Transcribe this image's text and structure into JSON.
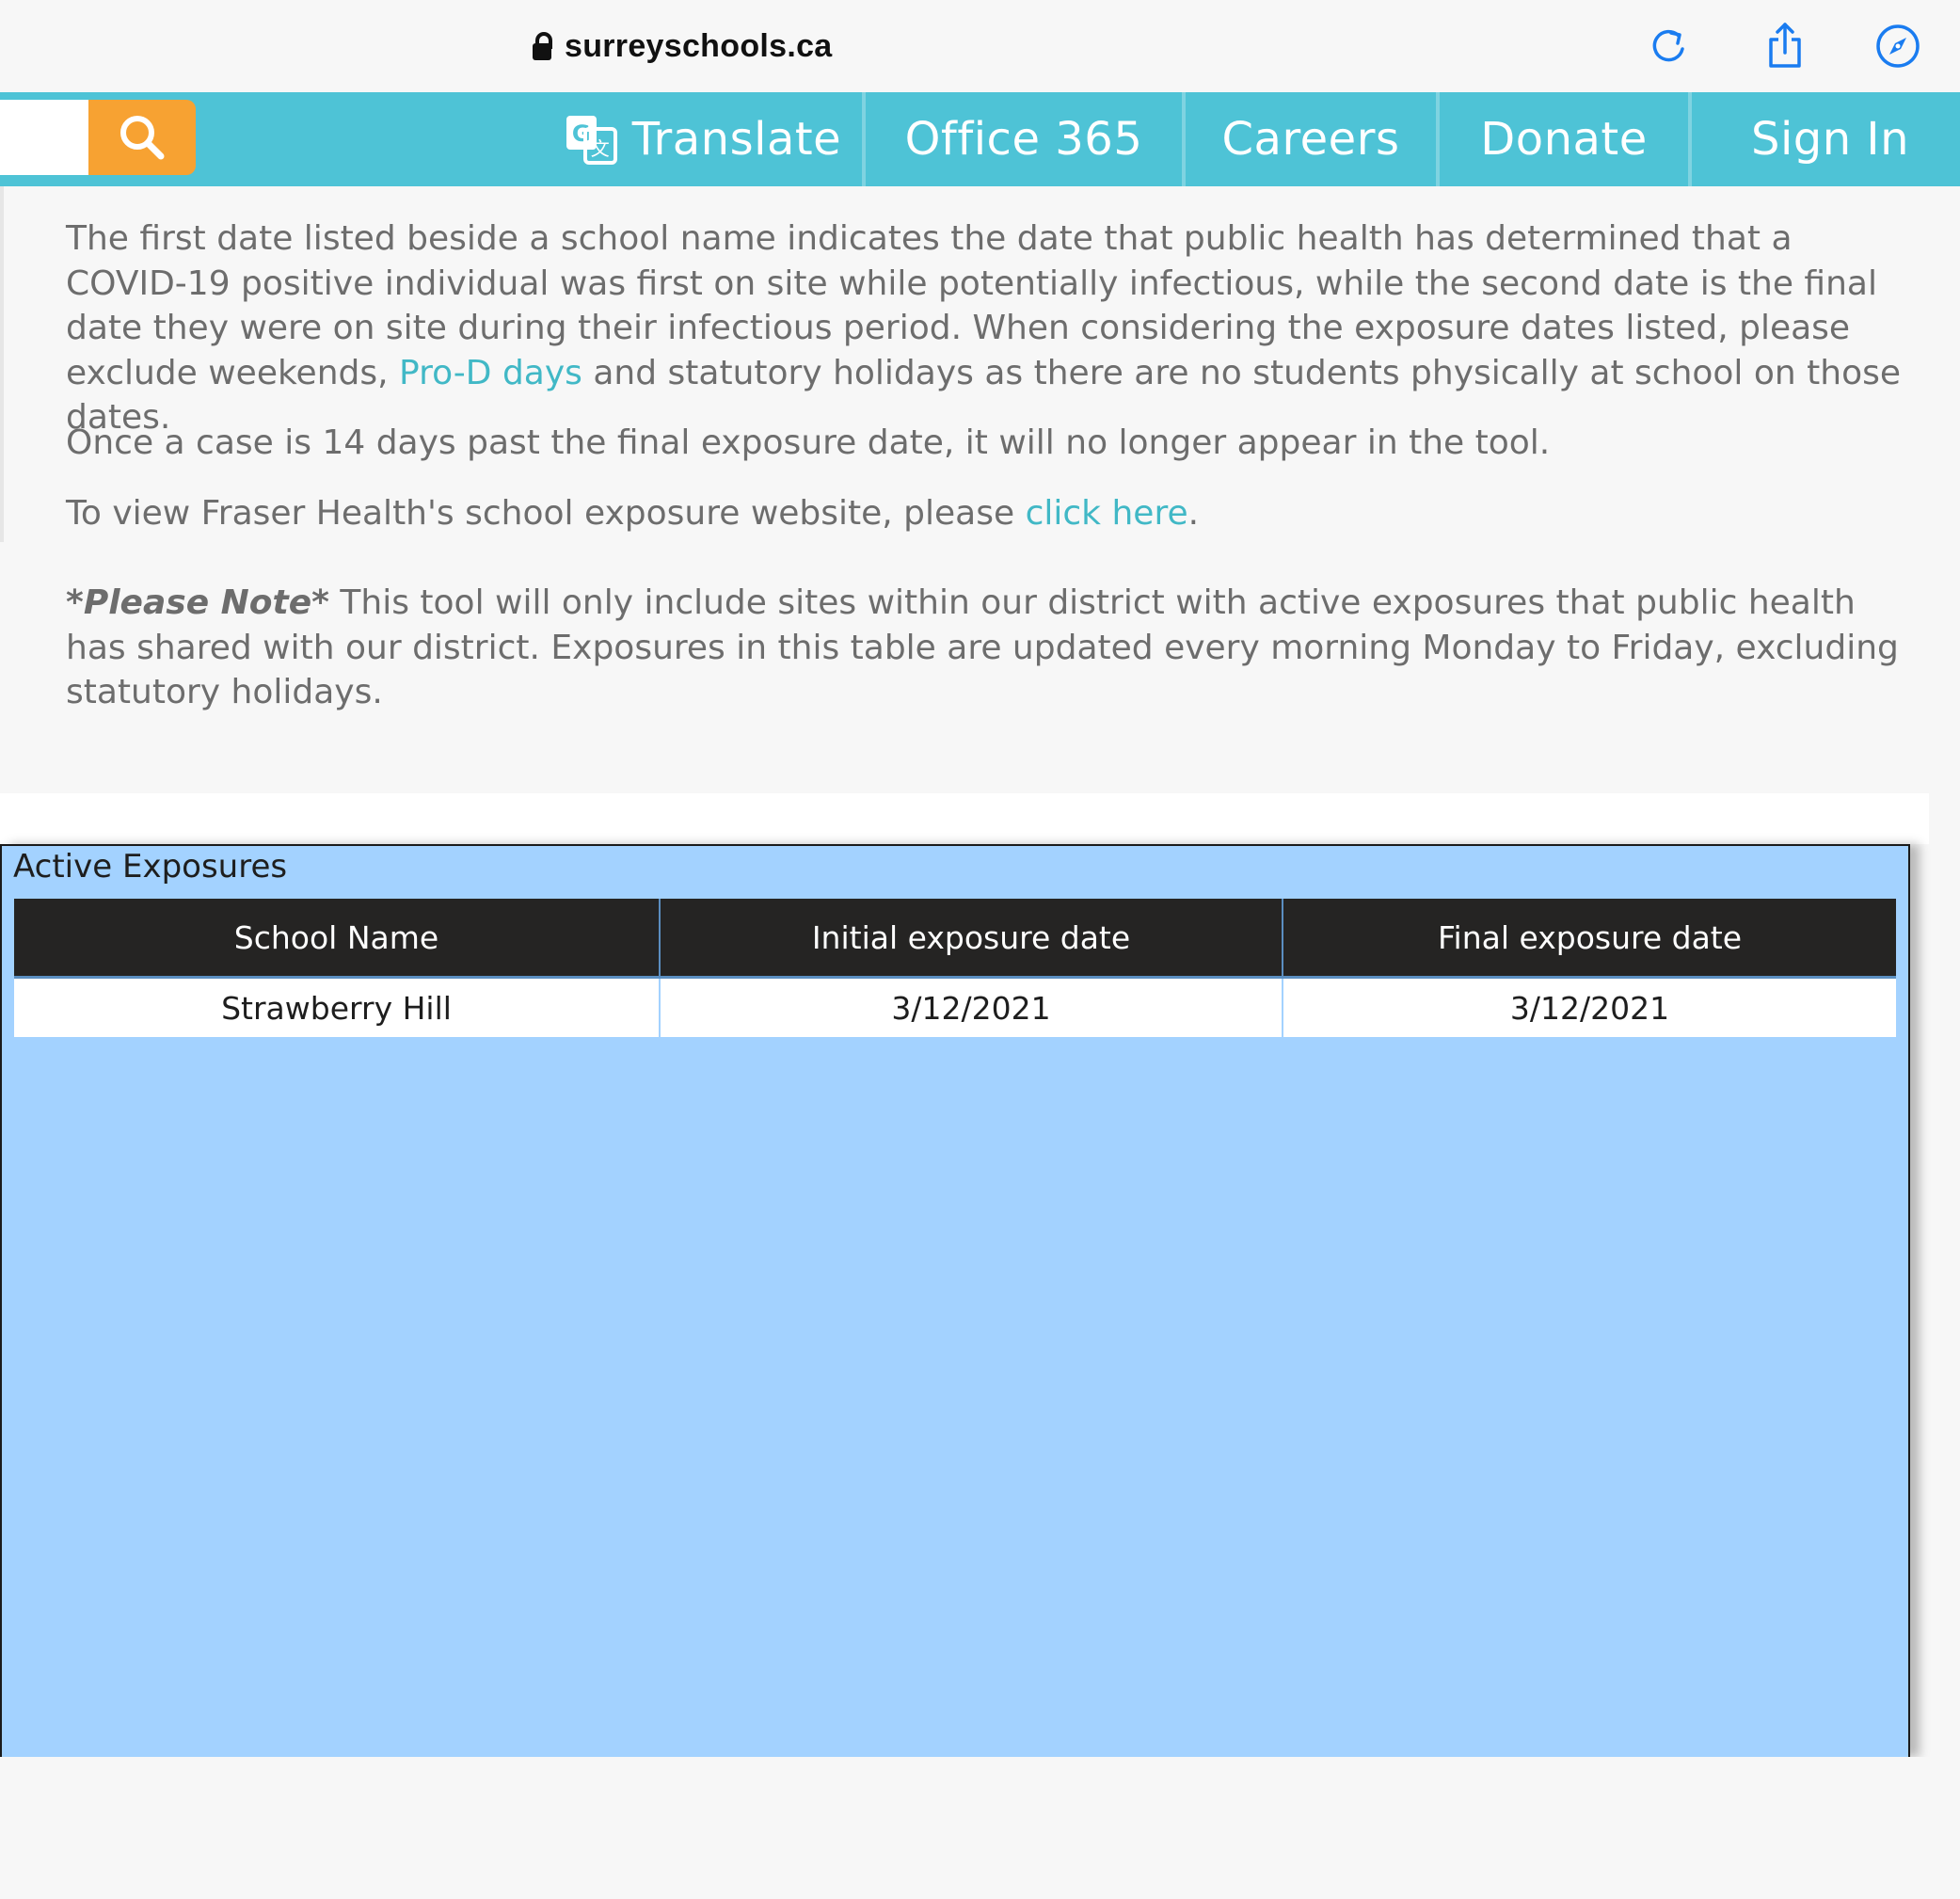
{
  "browser": {
    "url": "surreyschools.ca",
    "icons": [
      "lock-icon",
      "reload-icon",
      "share-icon",
      "compass-icon"
    ]
  },
  "nav": {
    "search_placeholder": "",
    "items": [
      {
        "label": "Translate",
        "icon": "translate-icon"
      },
      {
        "label": "Office 365"
      },
      {
        "label": "Careers"
      },
      {
        "label": "Donate"
      },
      {
        "label": "Sign In"
      }
    ]
  },
  "content": {
    "para1_before_link": "The first date listed beside a school name indicates the date that public health has determined that a COVID-19 positive individual was first on site while potentially infectious, while the second date is the final date they were on site during their infectious period. When considering the exposure dates listed, please exclude weekends, ",
    "para1_link": "Pro-D days",
    "para1_after_link": " and statutory holidays as there are no students physically at school on those dates.",
    "para2": "Once a case is 14 days past the final exposure date, it will no longer appear in the tool.",
    "para3_before_link": "To view Fraser Health's school exposure website, please ",
    "para3_link": "click here",
    "para3_after_link": ".",
    "note_label": "*Please Note*",
    "note_text": " This tool will only include sites within our district with active exposures that public health has shared with our district. Exposures in this table are updated every morning Monday to Friday, excluding statutory holidays."
  },
  "exposures": {
    "title": "Active Exposures",
    "columns": [
      "School Name",
      "Initial exposure date",
      "Final exposure date"
    ],
    "rows": [
      [
        "Strawberry Hill",
        "3/12/2021",
        "3/12/2021"
      ]
    ]
  },
  "colors": {
    "nav_bg": "#4ec3d6",
    "search_button": "#f7a232",
    "link": "#41b8c6",
    "panel_bg": "#a3d2ff",
    "table_header": "#252423"
  }
}
